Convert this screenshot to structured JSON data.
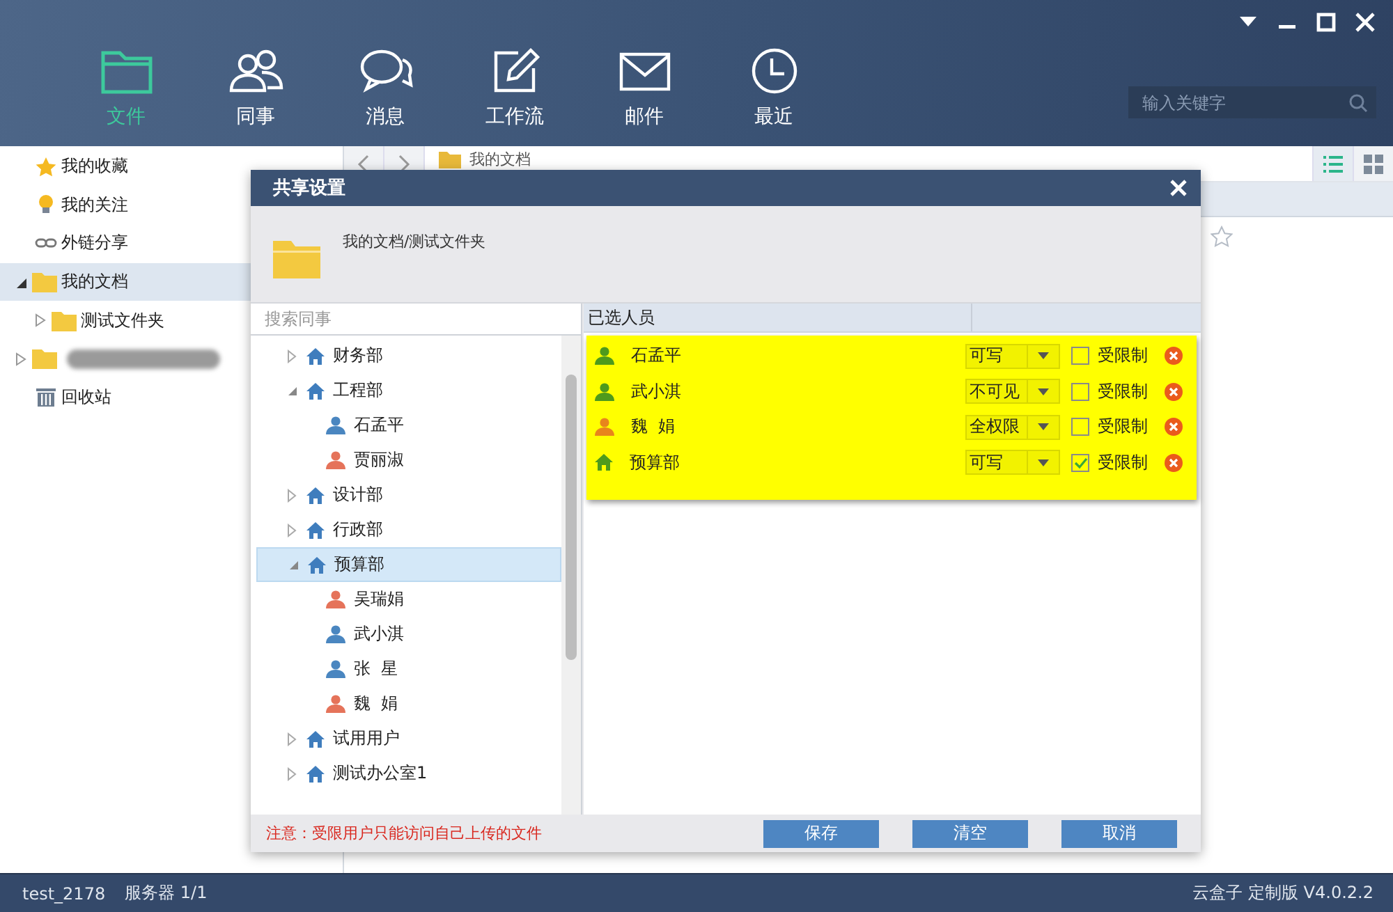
{
  "nav": {
    "tabs": [
      {
        "kind": "files",
        "label": "文件",
        "selected": true
      },
      {
        "kind": "colleagues",
        "label": "同事",
        "selected": false
      },
      {
        "kind": "messages",
        "label": "消息",
        "selected": false
      },
      {
        "kind": "workflow",
        "label": "工作流",
        "selected": false
      },
      {
        "kind": "mail",
        "label": "邮件",
        "selected": false
      },
      {
        "kind": "recent",
        "label": "最近",
        "selected": false
      }
    ],
    "search": {
      "placeholder": "输入关键字"
    }
  },
  "sidebar": {
    "items": [
      {
        "kind": "favorites",
        "label": "我的收藏",
        "selected": false
      },
      {
        "kind": "followed",
        "label": "我的关注",
        "selected": false
      },
      {
        "kind": "link",
        "label": "外链分享",
        "selected": false
      },
      {
        "kind": "folder",
        "label": "我的文档",
        "selected": true,
        "expanded": true,
        "children": [
          {
            "kind": "folder",
            "label": "测试文件夹",
            "selected": false,
            "expanded": false
          }
        ]
      },
      {
        "kind": "redacted",
        "selected": false,
        "expanded": false
      },
      {
        "kind": "trash",
        "label": "回收站",
        "selected": false
      }
    ]
  },
  "file_pane": {
    "breadcrumb": "我的文档",
    "views": [
      {
        "kind": "list",
        "selected": true
      },
      {
        "kind": "grid",
        "selected": false
      }
    ]
  },
  "dialog": {
    "title": "共享设置",
    "path": "我的文档/测试文件夹",
    "search": {
      "placeholder": "搜索同事"
    },
    "tree": [
      {
        "kind": "dept",
        "label": "财务部",
        "expanded": false,
        "selected": false
      },
      {
        "kind": "dept",
        "label": "工程部",
        "expanded": true,
        "selected": false,
        "children": [
          {
            "kind": "person",
            "label": "石孟平",
            "color": "#4a86c0",
            "selected": false
          },
          {
            "kind": "person",
            "label": "贾丽淑",
            "color": "#e5735a",
            "selected": false
          }
        ]
      },
      {
        "kind": "dept",
        "label": "设计部",
        "expanded": false,
        "selected": false
      },
      {
        "kind": "dept",
        "label": "行政部",
        "expanded": false,
        "selected": false
      },
      {
        "kind": "dept",
        "label": "预算部",
        "expanded": true,
        "selected": true,
        "children": [
          {
            "kind": "person",
            "label": "吴瑞娟",
            "color": "#e5735a",
            "selected": false
          },
          {
            "kind": "person",
            "label": "武小淇",
            "color": "#4a86c0",
            "selected": false
          },
          {
            "kind": "person",
            "label": "张  星",
            "color": "#4a86c0",
            "selected": false
          },
          {
            "kind": "person",
            "label": "魏  娟",
            "color": "#e5735a",
            "selected": false
          }
        ]
      },
      {
        "kind": "dept",
        "label": "试用用户",
        "expanded": false,
        "selected": false
      },
      {
        "kind": "dept",
        "label": "测试办公室1",
        "expanded": false,
        "selected": false
      }
    ],
    "selected_header": "已选人员",
    "members": [
      {
        "kind": "person",
        "name": "石孟平",
        "color": "#4e9a1c",
        "permission": "可写",
        "restricted": false,
        "restricted_label": "受限制"
      },
      {
        "kind": "person",
        "name": "武小淇",
        "color": "#4e9a1c",
        "permission": "不可见",
        "restricted": false,
        "restricted_label": "受限制"
      },
      {
        "kind": "person",
        "name": "魏  娟",
        "color": "#e8851c",
        "permission": "全权限",
        "restricted": false,
        "restricted_label": "受限制"
      },
      {
        "kind": "dept",
        "name": "预算部",
        "color": "#4e9a1c",
        "permission": "可写",
        "restricted": true,
        "restricted_label": "受限制"
      }
    ],
    "note": "注意：受限用户只能访问自己上传的文件",
    "buttons": [
      "保存",
      "清空",
      "取消"
    ]
  },
  "status_bar": {
    "user": "test_2178",
    "server": "服务器 1/1",
    "version": "云盒子 定制版 V4.0.2.2"
  }
}
